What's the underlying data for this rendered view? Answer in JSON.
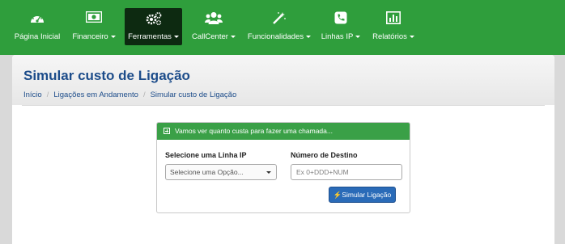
{
  "nav": {
    "items": [
      {
        "label": "Página Inicial",
        "icon": "dashboard-icon",
        "dropdown": false
      },
      {
        "label": "Financeiro",
        "icon": "money-icon",
        "dropdown": true
      },
      {
        "label": "Ferramentas",
        "icon": "gears-icon",
        "dropdown": true,
        "active": true
      },
      {
        "label": "CallCenter",
        "icon": "users-icon",
        "dropdown": true
      },
      {
        "label": "Funcionalidades",
        "icon": "magic-wand-icon",
        "dropdown": true
      },
      {
        "label": "Linhas IP",
        "icon": "phone-icon",
        "dropdown": true
      },
      {
        "label": "Relatórios",
        "icon": "bar-chart-icon",
        "dropdown": true
      }
    ]
  },
  "page": {
    "title": "Simular custo de Ligação",
    "breadcrumb": [
      "Início",
      "Ligações em Andamento",
      "Simular custo de Ligação"
    ]
  },
  "form": {
    "header": "Vamos ver quanto custa para fazer uma chamada...",
    "line_label": "Selecione uma Linha IP",
    "line_value": "Selecione uma Opção...",
    "dest_label": "Número de Destino",
    "dest_placeholder": "Ex 0+DDD+NUM",
    "submit_label": "Simular Ligação"
  },
  "colors": {
    "nav_green": "#2f9e3c",
    "nav_active": "#0d2a11",
    "title_blue": "#1c4c8a",
    "button_blue": "#2a6bb8"
  }
}
